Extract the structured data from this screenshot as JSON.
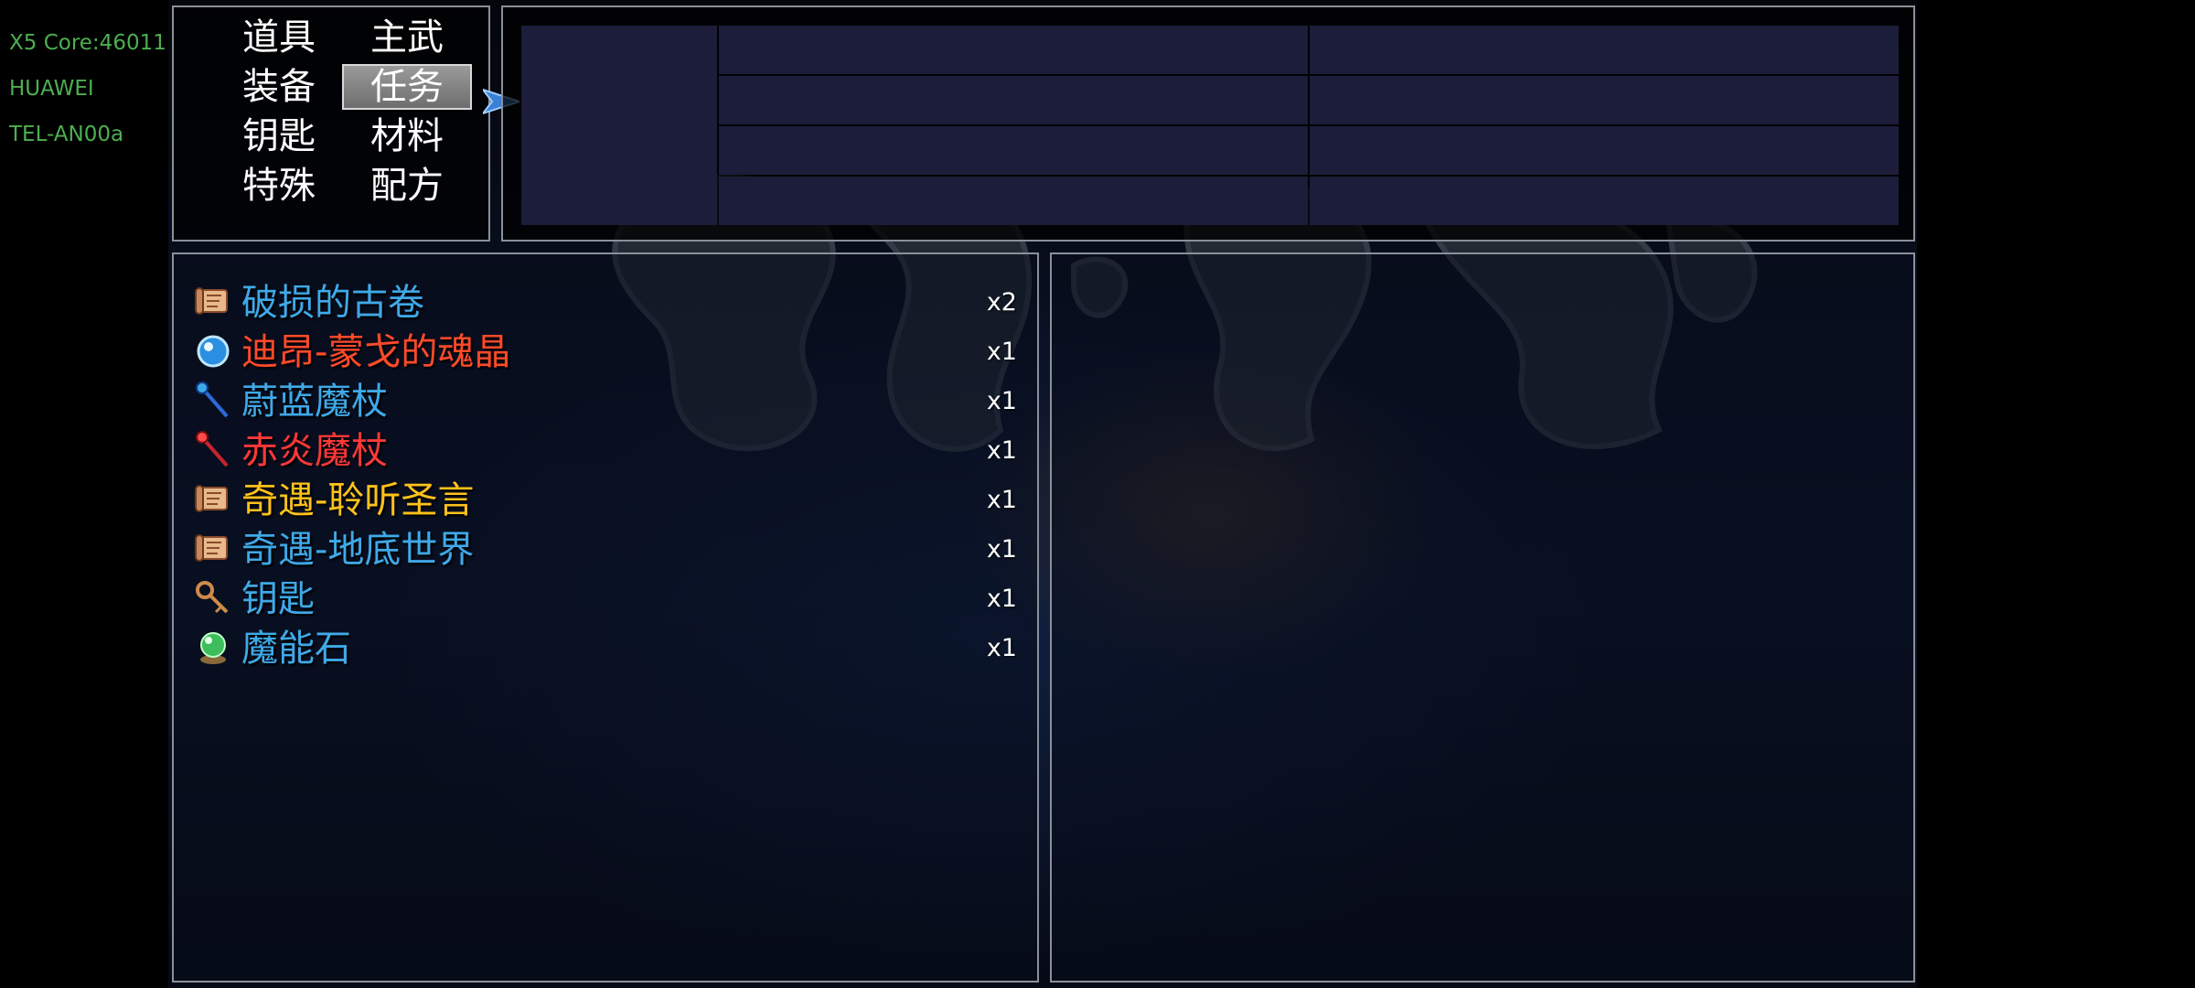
{
  "device_info": {
    "line1": "X5 Core:46011",
    "line2": "HUAWEI",
    "line3": "TEL-AN00a"
  },
  "categories": [
    {
      "label": "道具",
      "selected": false
    },
    {
      "label": "主武",
      "selected": false
    },
    {
      "label": "装备",
      "selected": false
    },
    {
      "label": "任务",
      "selected": true
    },
    {
      "label": "钥匙",
      "selected": false
    },
    {
      "label": "材料",
      "selected": false
    },
    {
      "label": "特殊",
      "selected": false
    },
    {
      "label": "配方",
      "selected": false
    }
  ],
  "items": [
    {
      "name": "破损的古卷",
      "qty": "x2",
      "color": "#3fa9e8",
      "icon": "scroll-icon"
    },
    {
      "name": "迪昂-蒙戈的魂晶",
      "qty": "x1",
      "color": "#ff4a2a",
      "icon": "soul-crystal-icon"
    },
    {
      "name": "蔚蓝魔杖",
      "qty": "x1",
      "color": "#3fa9e8",
      "icon": "blue-wand-icon"
    },
    {
      "name": "赤炎魔杖",
      "qty": "x1",
      "color": "#ff3838",
      "icon": "red-wand-icon"
    },
    {
      "name": "奇遇-聆听圣言",
      "qty": "x1",
      "color": "#ffc21a",
      "icon": "scroll-icon"
    },
    {
      "name": "奇遇-地底世界",
      "qty": "x1",
      "color": "#3fa9e8",
      "icon": "scroll-icon"
    },
    {
      "name": "钥匙",
      "qty": "x1",
      "color": "#3fa9e8",
      "icon": "key-icon"
    },
    {
      "name": "魔能石",
      "qty": "x1",
      "color": "#3fa9e8",
      "icon": "magic-stone-icon"
    }
  ],
  "colors": {
    "device_text": "#4caf50",
    "panel_border": "#8a8f9a",
    "info_cell": "#1b1d3a",
    "cursor": "#3b7fd6"
  }
}
